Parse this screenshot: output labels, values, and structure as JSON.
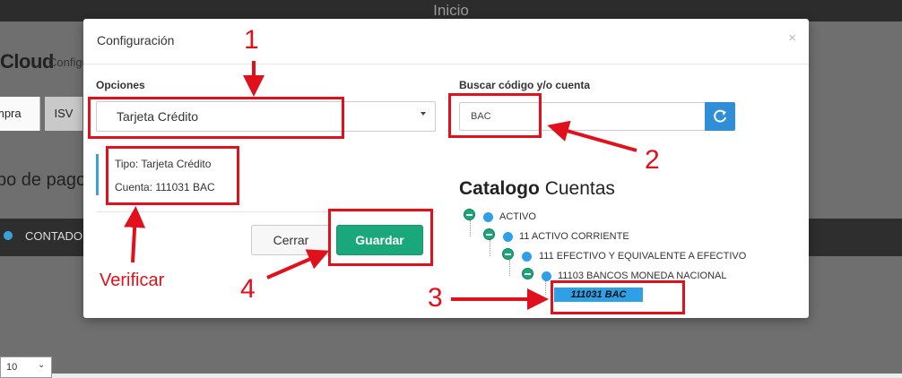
{
  "app": {
    "title": "Inicio",
    "brand": "Cloud",
    "brand_sub": "Configu"
  },
  "background": {
    "tabs": [
      "mpra",
      "ISV"
    ],
    "heading": "po de pago",
    "bar_label": "CONTADO",
    "page_size": "10"
  },
  "modal": {
    "title": "Configuración",
    "close": "×",
    "options_label": "Opciones",
    "options_selected": "Tarjeta Crédito",
    "info": {
      "tipo": "Tipo: Tarjeta Crédito",
      "cuenta": "Cuenta: 111031 BAC"
    },
    "buttons": {
      "cerrar": "Cerrar",
      "guardar": "Guardar"
    },
    "search": {
      "label": "Buscar código y/o cuenta",
      "value": "BAC"
    },
    "tree": {
      "title_bold": "Catalogo",
      "title_rest": "Cuentas",
      "nodes": [
        "ACTIVO",
        "11 ACTIVO CORRIENTE",
        "111 EFECTIVO Y EQUIVALENTE A EFECTIVO",
        "11103 BANCOS MONEDA NACIONAL",
        "111031 BAC"
      ]
    }
  },
  "annotations": {
    "n1": "1",
    "n2": "2",
    "n3": "3",
    "n4": "4",
    "verify": "Verificar"
  },
  "colors": {
    "annotation": "#e0101c",
    "accent": "#2f9fe6",
    "primary_button": "#1aa77a"
  },
  "icons": {
    "refresh": "refresh-icon",
    "caret": "caret-down-icon",
    "close": "close-icon"
  }
}
